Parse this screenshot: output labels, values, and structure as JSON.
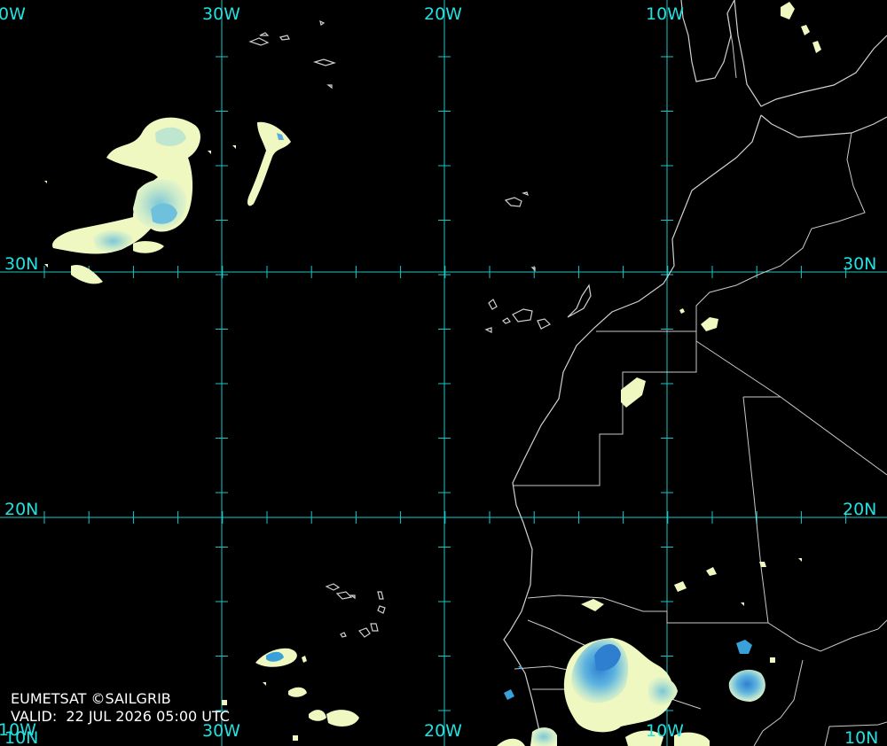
{
  "map": {
    "projection_note": "",
    "longitude_labels": {
      "w40_top": "0W",
      "w30_top": "30W",
      "w20_top": "20W",
      "w10_top": "10W",
      "w30_bottom": "30W",
      "w20_bottom": "20W",
      "w10_bottom": "10W",
      "w40_bottom": "10W"
    },
    "latitude_labels": {
      "n30_left": "30N",
      "n30_right": "30N",
      "n20_left": "20N",
      "n20_right": "20N",
      "n10_left": "10N",
      "n10_right": "10N"
    },
    "colors": {
      "grid": "#17c8c8",
      "label": "#22e0e0",
      "coast": "#d0d0d0",
      "cloud_light": "#eef8c0",
      "cloud_mid": "#a9dcc8",
      "cloud_deep": "#3aa0d8"
    }
  },
  "credit": {
    "line1": "EUMETSAT ©SAILGRIB",
    "line2": "VALID:  22 JUL 2026 05:00 UTC"
  }
}
